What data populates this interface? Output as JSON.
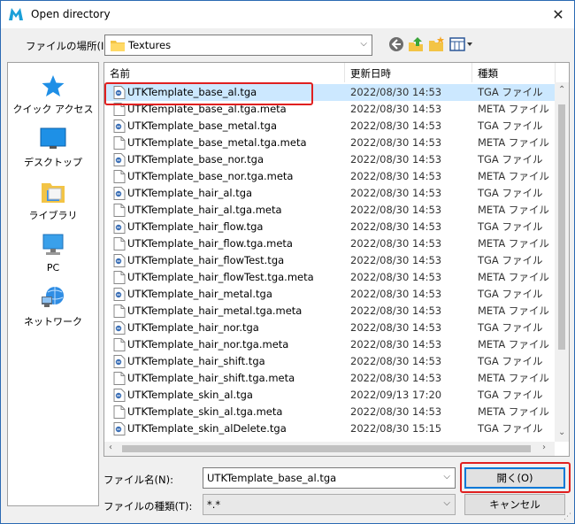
{
  "window": {
    "title": "Open directory"
  },
  "toolbar": {
    "lookin_label": "ファイルの場所(I):",
    "lookin_value": "Textures"
  },
  "places": [
    {
      "label": "クイック アクセス",
      "icon": "star-icon"
    },
    {
      "label": "デスクトップ",
      "icon": "desktop-icon"
    },
    {
      "label": "ライブラリ",
      "icon": "library-icon"
    },
    {
      "label": "PC",
      "icon": "pc-icon"
    },
    {
      "label": "ネットワーク",
      "icon": "network-icon"
    }
  ],
  "columns": {
    "name": "名前",
    "date": "更新日時",
    "type": "種類"
  },
  "files": [
    {
      "name": "UTKTemplate_base_al.tga",
      "date": "2022/08/30 14:53",
      "type": "TGA ファイル"
    },
    {
      "name": "UTKTemplate_base_al.tga.meta",
      "date": "2022/08/30 14:53",
      "type": "META ファイル"
    },
    {
      "name": "UTKTemplate_base_metal.tga",
      "date": "2022/08/30 14:53",
      "type": "TGA ファイル"
    },
    {
      "name": "UTKTemplate_base_metal.tga.meta",
      "date": "2022/08/30 14:53",
      "type": "META ファイル"
    },
    {
      "name": "UTKTemplate_base_nor.tga",
      "date": "2022/08/30 14:53",
      "type": "TGA ファイル"
    },
    {
      "name": "UTKTemplate_base_nor.tga.meta",
      "date": "2022/08/30 14:53",
      "type": "META ファイル"
    },
    {
      "name": "UTKTemplate_hair_al.tga",
      "date": "2022/08/30 14:53",
      "type": "TGA ファイル"
    },
    {
      "name": "UTKTemplate_hair_al.tga.meta",
      "date": "2022/08/30 14:53",
      "type": "META ファイル"
    },
    {
      "name": "UTKTemplate_hair_flow.tga",
      "date": "2022/08/30 14:53",
      "type": "TGA ファイル"
    },
    {
      "name": "UTKTemplate_hair_flow.tga.meta",
      "date": "2022/08/30 14:53",
      "type": "META ファイル"
    },
    {
      "name": "UTKTemplate_hair_flowTest.tga",
      "date": "2022/08/30 14:53",
      "type": "TGA ファイル"
    },
    {
      "name": "UTKTemplate_hair_flowTest.tga.meta",
      "date": "2022/08/30 14:53",
      "type": "META ファイル"
    },
    {
      "name": "UTKTemplate_hair_metal.tga",
      "date": "2022/08/30 14:53",
      "type": "TGA ファイル"
    },
    {
      "name": "UTKTemplate_hair_metal.tga.meta",
      "date": "2022/08/30 14:53",
      "type": "META ファイル"
    },
    {
      "name": "UTKTemplate_hair_nor.tga",
      "date": "2022/08/30 14:53",
      "type": "TGA ファイル"
    },
    {
      "name": "UTKTemplate_hair_nor.tga.meta",
      "date": "2022/08/30 14:53",
      "type": "META ファイル"
    },
    {
      "name": "UTKTemplate_hair_shift.tga",
      "date": "2022/08/30 14:53",
      "type": "TGA ファイル"
    },
    {
      "name": "UTKTemplate_hair_shift.tga.meta",
      "date": "2022/08/30 14:53",
      "type": "META ファイル"
    },
    {
      "name": "UTKTemplate_skin_al.tga",
      "date": "2022/09/13 17:20",
      "type": "TGA ファイル"
    },
    {
      "name": "UTKTemplate_skin_al.tga.meta",
      "date": "2022/08/30 14:53",
      "type": "META ファイル"
    },
    {
      "name": "UTKTemplate_skin_alDelete.tga",
      "date": "2022/08/30 15:15",
      "type": "TGA ファイル"
    }
  ],
  "filename": {
    "label": "ファイル名(N):",
    "value": "UTKTemplate_base_al.tga"
  },
  "filetype": {
    "label": "ファイルの種類(T):",
    "value": "*.*"
  },
  "buttons": {
    "open": "開く(O)",
    "cancel": "キャンセル"
  },
  "colors": {
    "selection": "#cce8ff",
    "highlight_box": "#e02020",
    "accent": "#0078d7"
  }
}
